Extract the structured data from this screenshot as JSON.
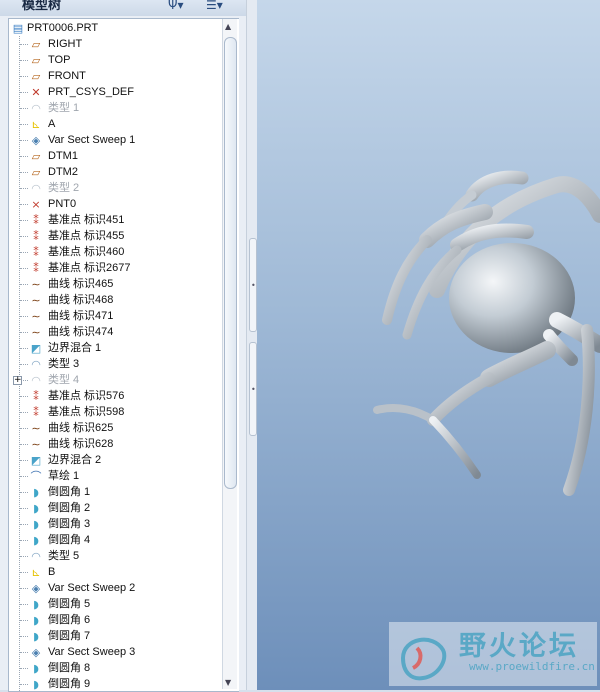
{
  "panel": {
    "title": "模型树",
    "show_icon": "Ψ▾",
    "settings_icon": "☰▾"
  },
  "tree": {
    "root": "PRT0006.PRT",
    "items": [
      {
        "label": "RIGHT",
        "icon": "plane-icon"
      },
      {
        "label": "TOP",
        "icon": "plane-icon"
      },
      {
        "label": "FRONT",
        "icon": "plane-icon"
      },
      {
        "label": "PRT_CSYS_DEF",
        "icon": "csys-icon"
      },
      {
        "label": "类型 1",
        "icon": "quilt-icon",
        "dim": true
      },
      {
        "label": "A",
        "icon": "csys-axis-icon"
      },
      {
        "label": "Var Sect Sweep 1",
        "icon": "sweep-icon"
      },
      {
        "label": "DTM1",
        "icon": "plane-icon"
      },
      {
        "label": "DTM2",
        "icon": "plane-icon"
      },
      {
        "label": "类型 2",
        "icon": "quilt-icon",
        "dim": true
      },
      {
        "label": "PNT0",
        "icon": "point-icon"
      },
      {
        "label": "基准点 标识451",
        "icon": "points-icon"
      },
      {
        "label": "基准点 标识455",
        "icon": "points-icon"
      },
      {
        "label": "基准点 标识460",
        "icon": "points-icon"
      },
      {
        "label": "基准点 标识2677",
        "icon": "points-icon"
      },
      {
        "label": "曲线 标识465",
        "icon": "curve-icon"
      },
      {
        "label": "曲线 标识468",
        "icon": "curve-icon"
      },
      {
        "label": "曲线 标识471",
        "icon": "curve-icon"
      },
      {
        "label": "曲线 标识474",
        "icon": "curve-icon"
      },
      {
        "label": "边界混合 1",
        "icon": "blend-icon"
      },
      {
        "label": "类型 3",
        "icon": "quilt-icon"
      },
      {
        "label": "类型 4",
        "icon": "quilt-icon",
        "dim": true,
        "expand": true
      },
      {
        "label": "基准点 标识576",
        "icon": "points-icon"
      },
      {
        "label": "基准点 标识598",
        "icon": "points-icon"
      },
      {
        "label": "曲线 标识625",
        "icon": "curve-icon"
      },
      {
        "label": "曲线 标识628",
        "icon": "curve-icon"
      },
      {
        "label": "边界混合 2",
        "icon": "blend-icon"
      },
      {
        "label": "草绘 1",
        "icon": "sketch-icon"
      },
      {
        "label": "倒圆角 1",
        "icon": "round-icon"
      },
      {
        "label": "倒圆角 2",
        "icon": "round-icon"
      },
      {
        "label": "倒圆角 3",
        "icon": "round-icon"
      },
      {
        "label": "倒圆角 4",
        "icon": "round-icon"
      },
      {
        "label": "类型 5",
        "icon": "quilt-icon"
      },
      {
        "label": "B",
        "icon": "csys-axis-icon"
      },
      {
        "label": "Var Sect Sweep 2",
        "icon": "sweep-icon"
      },
      {
        "label": "倒圆角 5",
        "icon": "round-icon"
      },
      {
        "label": "倒圆角 6",
        "icon": "round-icon"
      },
      {
        "label": "倒圆角 7",
        "icon": "round-icon"
      },
      {
        "label": "Var Sect Sweep 3",
        "icon": "sweep-icon"
      },
      {
        "label": "倒圆角 8",
        "icon": "round-icon"
      },
      {
        "label": "倒圆角 9",
        "icon": "round-icon"
      }
    ]
  },
  "watermark": {
    "title": "野火论坛",
    "url": "www.proewildfire.cn"
  },
  "colors": {
    "plane": "#b5651d",
    "point": "#c0392b",
    "curve": "#7a3e12",
    "blend": "#4aa3c9",
    "csys": "#e6c200"
  }
}
